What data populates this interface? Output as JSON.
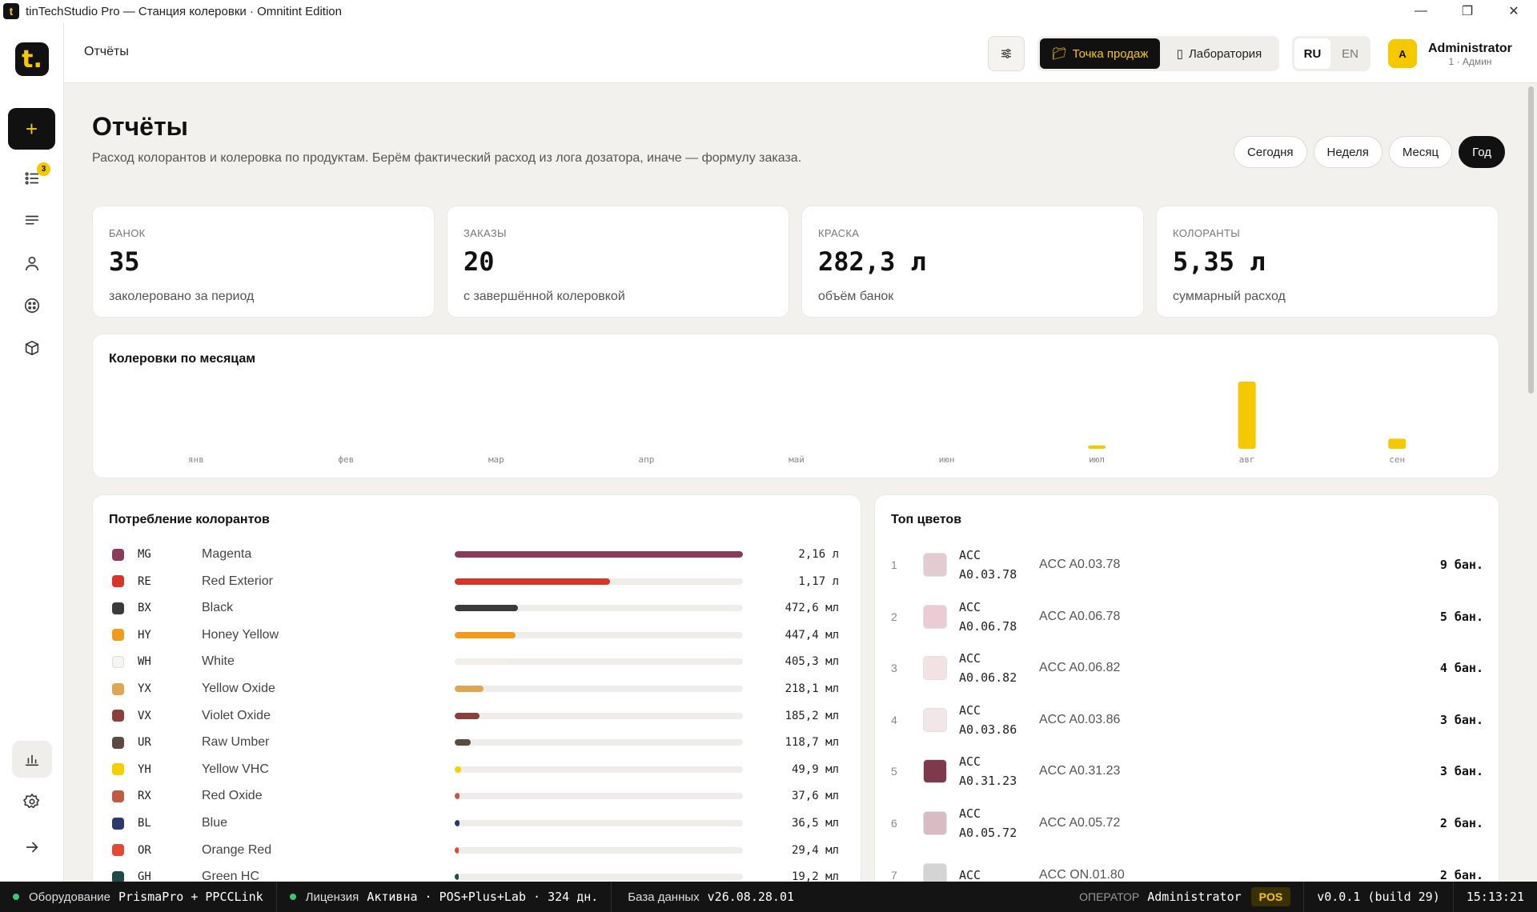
{
  "window": {
    "title": "tinTechStudio Pro — Станция колеровки · Omnitint Edition",
    "logo": "t"
  },
  "sidebar": {
    "brand": "t.",
    "badge": "3"
  },
  "topbar": {
    "page_title": "Отчёты",
    "mode_pos": "Точка продаж",
    "mode_lab": "Лаборатория",
    "lang_ru": "RU",
    "lang_en": "EN",
    "avatar": "A",
    "user_name": "Administrator",
    "user_role": "1 · Админ"
  },
  "page": {
    "title": "Отчёты",
    "subtitle": "Расход колорантов и колеровка по продуктам. Берём фактический расход из лога дозатора, иначе — формулу заказа.",
    "periods": [
      "Сегодня",
      "Неделя",
      "Месяц",
      "Год"
    ],
    "active_period": "Год"
  },
  "kpis": [
    {
      "label": "БАНОК",
      "value": "35",
      "sub": "заколеровано за период"
    },
    {
      "label": "ЗАКАЗЫ",
      "value": "20",
      "sub": "с завершённой колеровкой"
    },
    {
      "label": "КРАСКА",
      "value": "282,3 л",
      "sub": "объём банок"
    },
    {
      "label": "КОЛОРАНТЫ",
      "value": "5,35 л",
      "sub": "суммарный расход"
    }
  ],
  "chart_data": {
    "type": "bar",
    "title": "Колеровки по месяцам",
    "categories": [
      "янв",
      "фев",
      "мар",
      "апр",
      "май",
      "июн",
      "июл",
      "авг",
      "сен"
    ],
    "values": [
      0,
      0,
      0,
      0,
      0,
      0,
      1,
      20,
      3
    ],
    "ylim": [
      0,
      20
    ],
    "color": "#f5c800"
  },
  "consumption": {
    "title": "Потребление колорантов",
    "rows": [
      {
        "code": "MG",
        "name": "Magenta",
        "amount": "2,16 л",
        "ratio": 1.0,
        "color": "#8b3a5a"
      },
      {
        "code": "RE",
        "name": "Red Exterior",
        "amount": "1,17 л",
        "ratio": 0.54,
        "color": "#d8352a"
      },
      {
        "code": "BX",
        "name": "Black",
        "amount": "472,6 мл",
        "ratio": 0.22,
        "color": "#3a3a3a"
      },
      {
        "code": "HY",
        "name": "Honey Yellow",
        "amount": "447,4 мл",
        "ratio": 0.21,
        "color": "#f39a1c"
      },
      {
        "code": "WH",
        "name": "White",
        "amount": "405,3 мл",
        "ratio": 0.19,
        "color": "#f7f5f0"
      },
      {
        "code": "YX",
        "name": "Yellow Oxide",
        "amount": "218,1 мл",
        "ratio": 0.1,
        "color": "#e0a552"
      },
      {
        "code": "VX",
        "name": "Violet Oxide",
        "amount": "185,2 мл",
        "ratio": 0.086,
        "color": "#8a3f3a"
      },
      {
        "code": "UR",
        "name": "Raw Umber",
        "amount": "118,7 мл",
        "ratio": 0.055,
        "color": "#5a4a40"
      },
      {
        "code": "YH",
        "name": "Yellow VHC",
        "amount": "49,9 мл",
        "ratio": 0.023,
        "color": "#f5d000"
      },
      {
        "code": "RX",
        "name": "Red Oxide",
        "amount": "37,6 мл",
        "ratio": 0.017,
        "color": "#c05a40"
      },
      {
        "code": "BL",
        "name": "Blue",
        "amount": "36,5 мл",
        "ratio": 0.017,
        "color": "#2a3a6a"
      },
      {
        "code": "OR",
        "name": "Orange Red",
        "amount": "29,4 мл",
        "ratio": 0.014,
        "color": "#e04a30"
      },
      {
        "code": "GH",
        "name": "Green HC",
        "amount": "19,2 мл",
        "ratio": 0.009,
        "color": "#1e4a48"
      }
    ]
  },
  "top_colors": {
    "title": "Топ цветов",
    "rows": [
      {
        "rank": "1",
        "code1": "ACC",
        "code2": "A0.03.78",
        "name": "ACC A0.03.78",
        "count": "9 бан.",
        "color": "#e2ccd2"
      },
      {
        "rank": "2",
        "code1": "ACC",
        "code2": "A0.06.78",
        "name": "ACC A0.06.78",
        "count": "5 бан.",
        "color": "#ecccd4"
      },
      {
        "rank": "3",
        "code1": "ACC",
        "code2": "A0.06.82",
        "name": "ACC A0.06.82",
        "count": "4 бан.",
        "color": "#f3e2e4"
      },
      {
        "rank": "4",
        "code1": "ACC",
        "code2": "A0.03.86",
        "name": "ACC A0.03.86",
        "count": "3 бан.",
        "color": "#f3e6e8"
      },
      {
        "rank": "5",
        "code1": "ACC",
        "code2": "A0.31.23",
        "name": "ACC A0.31.23",
        "count": "3 бан.",
        "color": "#7e3a4a"
      },
      {
        "rank": "6",
        "code1": "ACC",
        "code2": "A0.05.72",
        "name": "ACC A0.05.72",
        "count": "2 бан.",
        "color": "#d8bcc4"
      },
      {
        "rank": "7",
        "code1": "ACC",
        "code2": "",
        "name": "ACC ON.01.80",
        "count": "2 бан.",
        "color": "#d4d4d4"
      }
    ]
  },
  "statusbar": {
    "equip_label": "Оборудование",
    "equip_value": "PrismaPro + PPCCLink",
    "license_label": "Лицензия",
    "license_value": "Активна · POS+Plus+Lab · 324 дн.",
    "db_label": "База данных",
    "db_value": "v26.08.28.01",
    "operator_label": "ОПЕРАТОР",
    "operator_value": "Administrator",
    "mode": "POS",
    "version": "v0.0.1 (build 29)",
    "time": "15:13:21"
  }
}
